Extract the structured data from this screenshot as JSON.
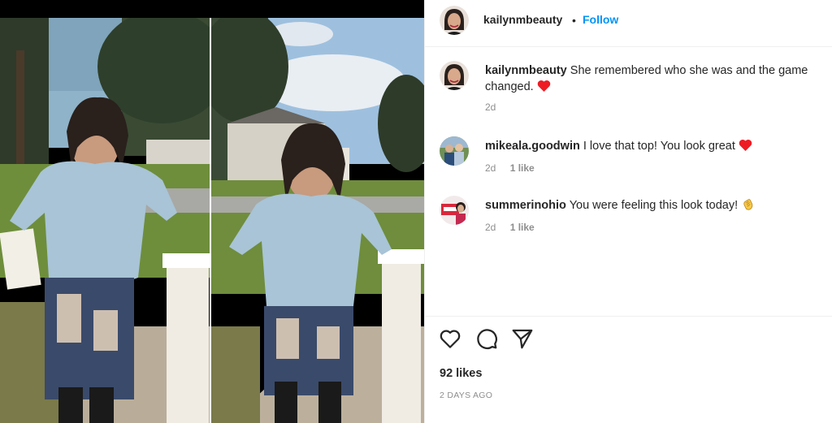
{
  "post": {
    "author": "kailynmbeauty",
    "follow_label": "Follow",
    "separator": "•"
  },
  "caption": {
    "username": "kailynmbeauty",
    "text": "She remembered who she was and the game changed.",
    "emoji": "heart",
    "time": "2d"
  },
  "comments": [
    {
      "username": "mikeala.goodwin",
      "text": "I love that top! You look great",
      "emoji": "heart",
      "time": "2d",
      "likes": "1 like"
    },
    {
      "username": "summerinohio",
      "text": "You were feeling this look today!",
      "emoji": "clap",
      "time": "2d",
      "likes": "1 like"
    }
  ],
  "actions": {
    "like_icon": "heart-outline-icon",
    "comment_icon": "speech-bubble-icon",
    "share_icon": "paper-plane-icon"
  },
  "stats": {
    "likes": "92 likes",
    "posted": "2 DAYS AGO"
  },
  "colors": {
    "link": "#0095f6",
    "text": "#262626",
    "muted": "#8e8e8e",
    "heart": "#ed1c24"
  }
}
